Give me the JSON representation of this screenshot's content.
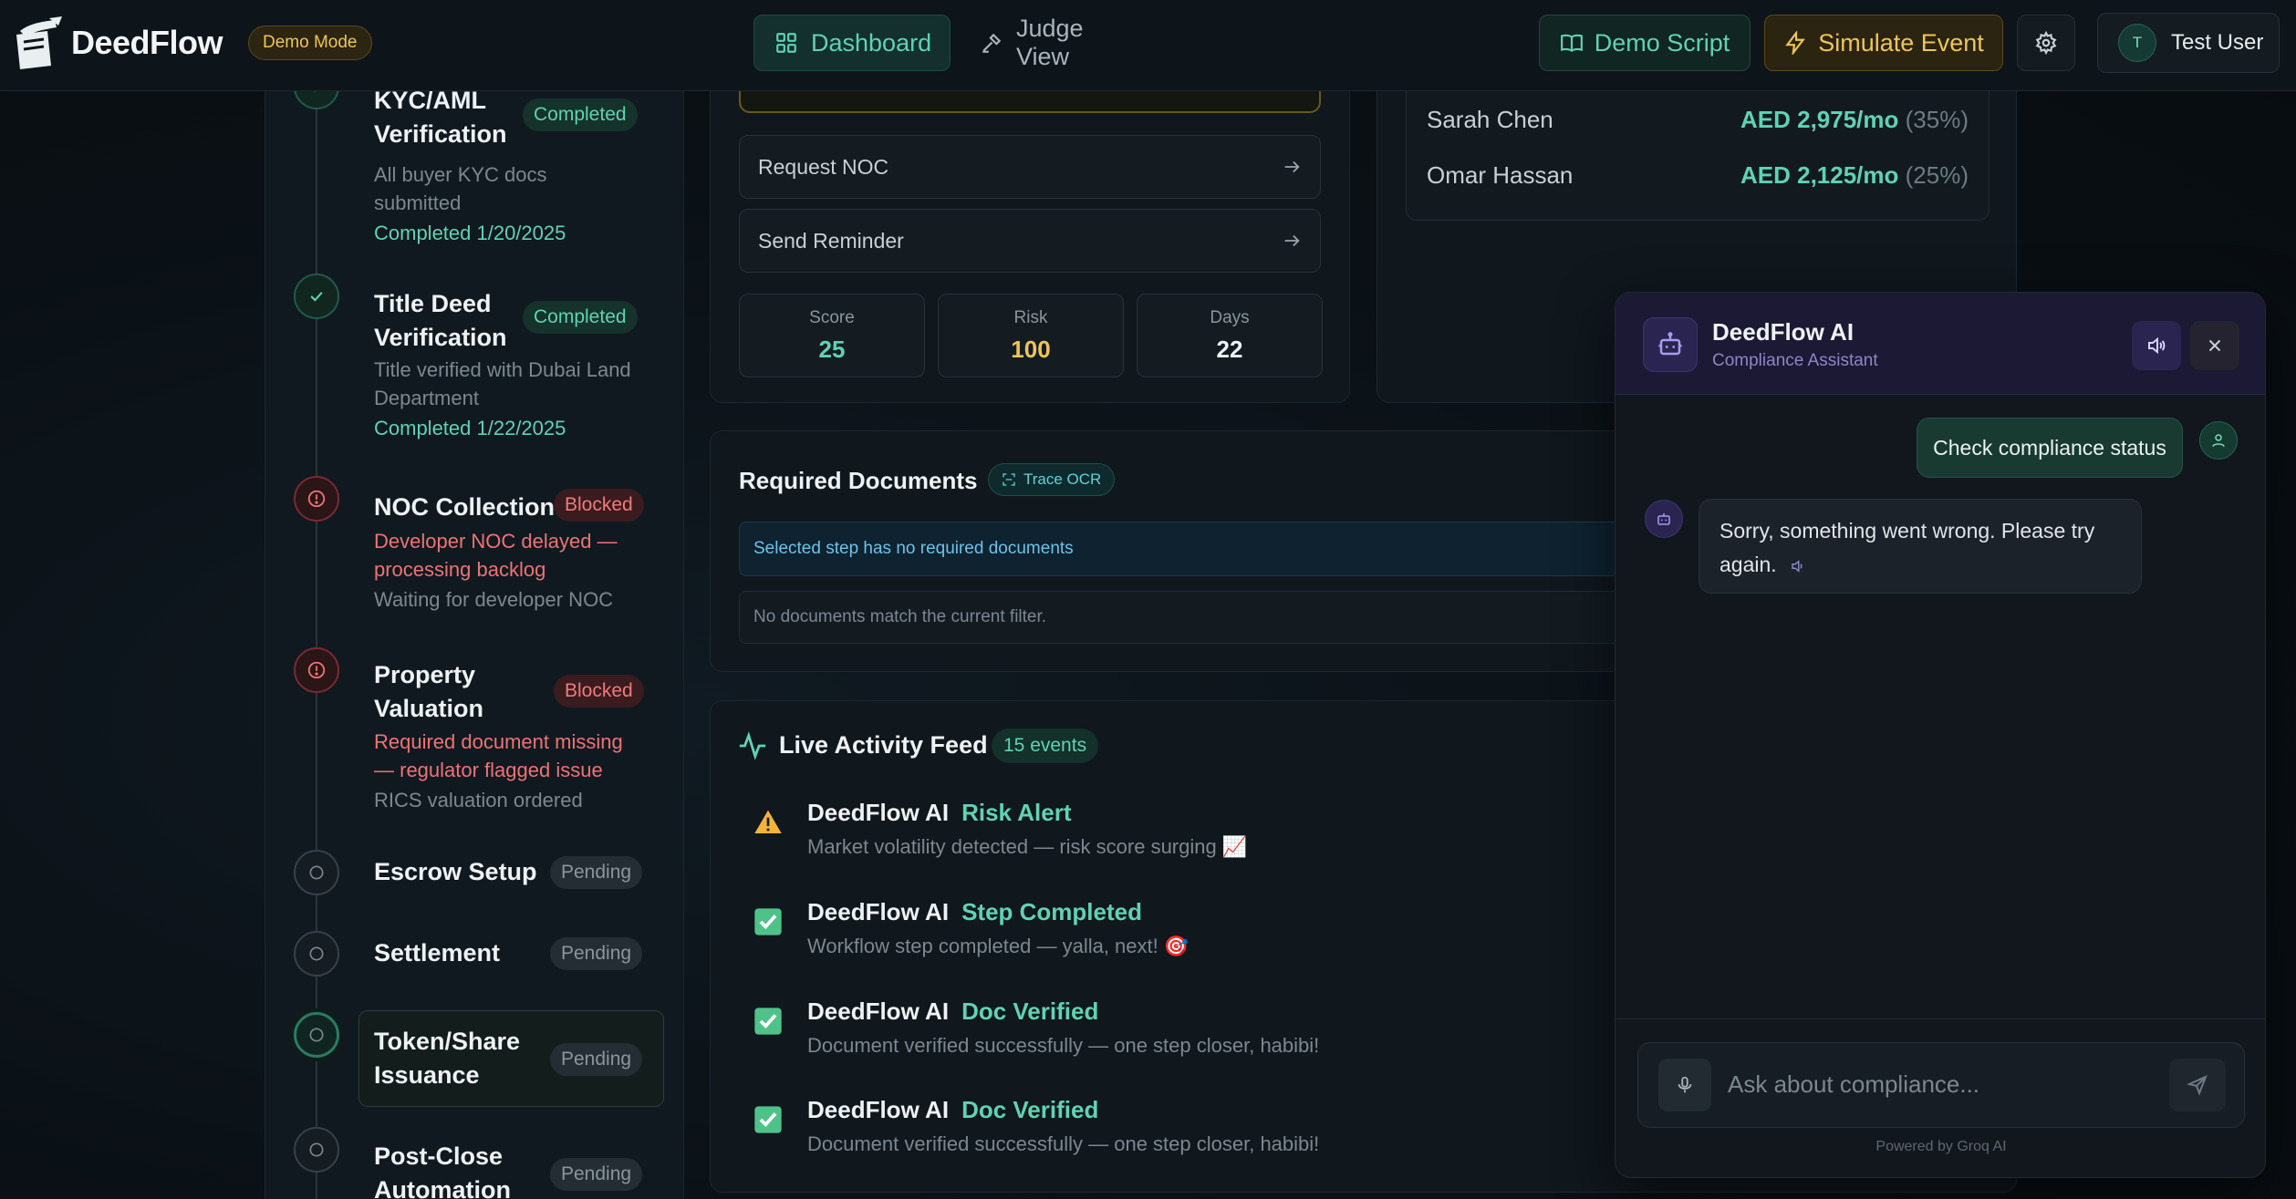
{
  "header": {
    "brand": "DeedFlow",
    "demo_badge": "Demo Mode",
    "nav": {
      "dashboard": "Dashboard",
      "judge_view": "Judge View"
    },
    "demo_script": "Demo Script",
    "simulate_event": "Simulate Event",
    "user": {
      "initial": "T",
      "name": "Test User"
    }
  },
  "timeline": {
    "steps": [
      {
        "title_line1": "KYC/AML",
        "title_line2": "Verification",
        "status": "Completed",
        "note_line1": "All buyer KYC docs",
        "note_line2": "submitted",
        "completed": "Completed 1/20/2025"
      },
      {
        "title_line1": "Title Deed",
        "title_line2": "Verification",
        "status": "Completed",
        "note_line1": "Title verified with Dubai Land",
        "note_line2": "Department",
        "completed": "Completed 1/22/2025"
      },
      {
        "title": "NOC Collection",
        "status": "Blocked",
        "alert_line1": "Developer NOC delayed —",
        "alert_line2": "processing backlog",
        "note": "Waiting for developer NOC"
      },
      {
        "title_line1": "Property",
        "title_line2": "Valuation",
        "status": "Blocked",
        "alert_line1": "Required document missing",
        "alert_line2": "— regulator flagged issue",
        "note": "RICS valuation ordered"
      },
      {
        "title": "Escrow Setup",
        "status": "Pending"
      },
      {
        "title": "Settlement",
        "status": "Pending"
      },
      {
        "title_line1": "Token/Share",
        "title_line2": "Issuance",
        "status": "Pending"
      },
      {
        "title_line1": "Post-Close",
        "title_line2": "Automation",
        "status": "Pending"
      }
    ]
  },
  "actions": {
    "request_noc": "Request NOC",
    "send_reminder": "Send Reminder",
    "stats": [
      {
        "label": "Score",
        "value": "25",
        "color": "#5fd3b2"
      },
      {
        "label": "Risk",
        "value": "100",
        "color": "#f0c45a"
      },
      {
        "label": "Days",
        "value": "22",
        "color": "#eef2f4"
      }
    ]
  },
  "holders": [
    {
      "name": "Sarah Chen",
      "amount": "AED 2,975/mo",
      "pct": "(35%)"
    },
    {
      "name": "Omar Hassan",
      "amount": "AED 2,125/mo",
      "pct": "(25%)"
    }
  ],
  "documents": {
    "title": "Required Documents",
    "trace_ocr": "Trace OCR",
    "info": "Selected step has no required documents",
    "empty": "No documents match the current filter."
  },
  "feed": {
    "title": "Live Activity Feed",
    "count": "15 events",
    "events": [
      {
        "icon": "warning-icon",
        "actor": "DeedFlow AI",
        "type": "Risk Alert",
        "desc": "Market volatility detected — risk score surging 📈"
      },
      {
        "icon": "check-icon",
        "actor": "DeedFlow AI",
        "type": "Step Completed",
        "desc": "Workflow step completed — yalla, next! 🎯"
      },
      {
        "icon": "check-icon",
        "actor": "DeedFlow AI",
        "type": "Doc Verified",
        "desc": "Document verified successfully — one step closer, habibi!"
      },
      {
        "icon": "check-icon",
        "actor": "DeedFlow AI",
        "type": "Doc Verified",
        "desc": "Document verified successfully — one step closer, habibi!"
      }
    ]
  },
  "chat": {
    "title": "DeedFlow AI",
    "subtitle": "Compliance Assistant",
    "user_message": "Check compliance status",
    "bot_message": "Sorry, something went wrong. Please try again.",
    "input_placeholder": "Ask about compliance...",
    "powered_by": "Powered by Groq AI"
  },
  "colors": {
    "accent": "#5fd3b2",
    "warning": "#f0c45a",
    "danger": "#ee7373",
    "chat_header": "#1b1933"
  }
}
